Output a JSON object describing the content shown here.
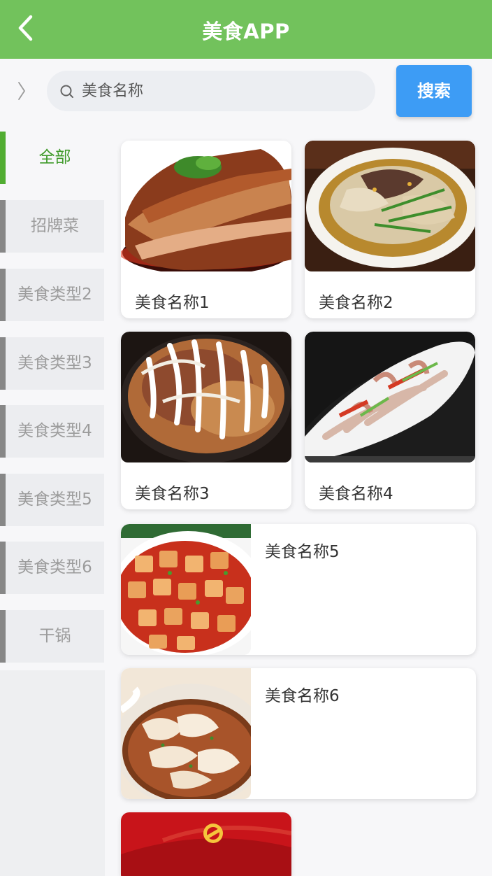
{
  "header": {
    "title": "美食APP",
    "back_icon": "chevron-left-icon"
  },
  "search": {
    "placeholder": "美食名称",
    "value": "",
    "button_label": "搜索",
    "expand_icon": "chevron-right-icon",
    "search_icon": "search-icon"
  },
  "sidebar": {
    "items": [
      {
        "label": "全部",
        "active": true
      },
      {
        "label": "招牌菜",
        "active": false
      },
      {
        "label": "美食类型2",
        "active": false
      },
      {
        "label": "美食类型3",
        "active": false
      },
      {
        "label": "美食类型4",
        "active": false
      },
      {
        "label": "美食类型5",
        "active": false
      },
      {
        "label": "美食类型6",
        "active": false
      },
      {
        "label": "干锅",
        "active": false
      }
    ]
  },
  "foods": [
    {
      "name": "美食名称1",
      "image": "braised-pork-photo"
    },
    {
      "name": "美食名称2",
      "image": "beef-noodle-soup-photo"
    },
    {
      "name": "美食名称3",
      "image": "okonomiyaki-photo"
    },
    {
      "name": "美食名称4",
      "image": "stir-fried-squid-photo"
    },
    {
      "name": "美食名称5",
      "image": "mapo-tofu-photo"
    },
    {
      "name": "美食名称6",
      "image": "wonton-soup-photo"
    },
    {
      "name": "",
      "image": "red-banner-photo"
    }
  ],
  "colors": {
    "header": "#72c25c",
    "active_tab": "#51ad32",
    "search_button": "#3d9cf5",
    "inactive_tab_border": "#878787"
  }
}
